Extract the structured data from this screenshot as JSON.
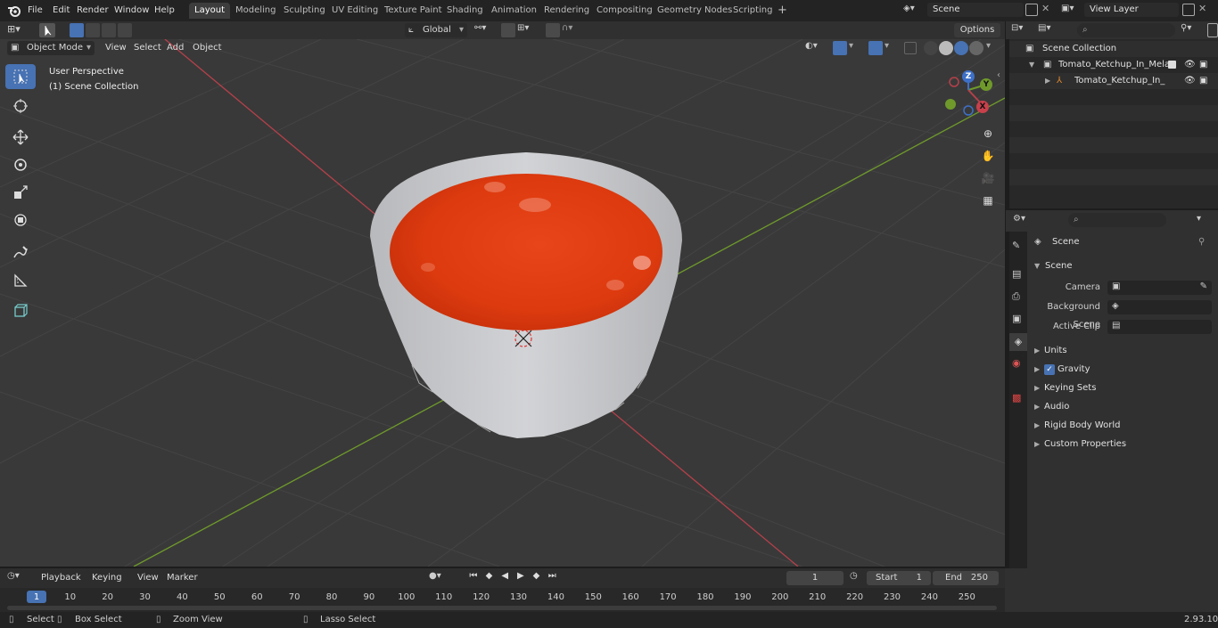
{
  "menu": [
    "File",
    "Edit",
    "Render",
    "Window",
    "Help"
  ],
  "workspaces": [
    {
      "label": "Layout",
      "active": true
    },
    {
      "label": "Modeling"
    },
    {
      "label": "Sculpting"
    },
    {
      "label": "UV Editing"
    },
    {
      "label": "Texture Paint"
    },
    {
      "label": "Shading"
    },
    {
      "label": "Animation"
    },
    {
      "label": "Rendering"
    },
    {
      "label": "Compositing"
    },
    {
      "label": "Geometry Nodes"
    },
    {
      "label": "Scripting"
    }
  ],
  "add_workspace": "+",
  "scene_field": "Scene",
  "view_layer_field": "View Layer",
  "viewport": {
    "mode": "Object Mode",
    "menus": [
      "View",
      "Select",
      "Add",
      "Object"
    ],
    "orientation": "Global",
    "options": "Options",
    "overlay_line1": "User Perspective",
    "overlay_line2": "(1) Scene Collection",
    "gizmo_axes": {
      "x": "X",
      "y": "Y",
      "z": "Z"
    }
  },
  "outliner": {
    "root": "Scene Collection",
    "items": [
      {
        "label": "Tomato_Ketchup_In_Melamine"
      },
      {
        "label": "Tomato_Ketchup_In_Mela"
      }
    ]
  },
  "properties": {
    "header": "Scene",
    "panel": "Scene",
    "camera_label": "Camera",
    "bg_scene_label": "Background Scene",
    "active_clip_label": "Active Clip",
    "sections": [
      "Units",
      "Gravity",
      "Keying Sets",
      "Audio",
      "Rigid Body World",
      "Custom Properties"
    ]
  },
  "timeline": {
    "menus": [
      "Playback",
      "Keying",
      "View",
      "Marker"
    ],
    "current_frame": "1",
    "start_label": "Start",
    "start_value": "1",
    "end_label": "End",
    "end_value": "250",
    "ticks": [
      "1",
      "10",
      "20",
      "30",
      "40",
      "50",
      "60",
      "70",
      "80",
      "90",
      "100",
      "110",
      "120",
      "130",
      "140",
      "150",
      "160",
      "170",
      "180",
      "190",
      "200",
      "210",
      "220",
      "230",
      "240",
      "250"
    ]
  },
  "statusbar": {
    "select": "Select",
    "box_select": "Box Select",
    "zoom_view": "Zoom View",
    "lasso_select": "Lasso Select",
    "version": "2.93.10"
  },
  "colors": {
    "accent": "#4772b3",
    "x_axis": "#b5404a",
    "y_axis": "#6f9a2b",
    "ketchup": "#e13a10",
    "bowl": "#c9cacd"
  }
}
